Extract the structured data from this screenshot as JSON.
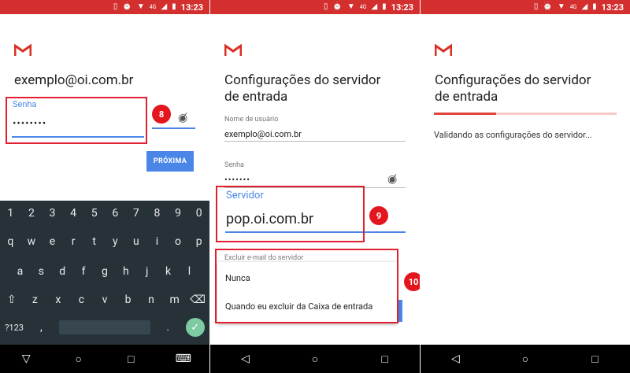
{
  "status": {
    "time": "13:23",
    "network": "4G",
    "icons": [
      "vibrate-icon",
      "alarm-icon",
      "wifi-icon",
      "signal-icon",
      "battery-icon"
    ]
  },
  "panel1": {
    "email": "exemplo@oi.com.br",
    "password_label": "Senha",
    "password_value": "••••••••",
    "next_button": "PRÓXIMA",
    "badge": "8",
    "keyboard": {
      "row_numbers": [
        "1",
        "2",
        "3",
        "4",
        "5",
        "6",
        "7",
        "8",
        "9",
        "0"
      ],
      "row1": [
        "q",
        "w",
        "e",
        "r",
        "t",
        "y",
        "u",
        "i",
        "o",
        "p"
      ],
      "row2": [
        "a",
        "s",
        "d",
        "f",
        "g",
        "h",
        "j",
        "k",
        "l"
      ],
      "row3": [
        "z",
        "x",
        "c",
        "v",
        "b",
        "n",
        "m"
      ],
      "symbols_key": "?123",
      "comma_key": ","
    }
  },
  "panel2": {
    "title_line1": "Configurações do servidor",
    "title_line2": "de entrada",
    "username_label": "Nome de usuário",
    "username_value": "exemplo@oi.com.br",
    "password_label": "Senha",
    "password_value": "•••••••",
    "server_label": "Servidor",
    "server_value": "pop.oi.com.br",
    "badge_server": "9",
    "delete_label": "Excluir e-mail do servidor",
    "delete_options": [
      "Nunca",
      "Quando eu excluir da Caixa de entrada"
    ],
    "badge_delete": "10"
  },
  "panel3": {
    "title_line1": "Configurações do servidor",
    "title_line2": "de entrada",
    "validating_text": "Validando as configurações do servidor...",
    "progress_fraction": 0.34
  },
  "colors": {
    "status_bar": "#d32f2f",
    "accent_blue": "#4a86e8",
    "annotation_red": "#e0202e"
  }
}
